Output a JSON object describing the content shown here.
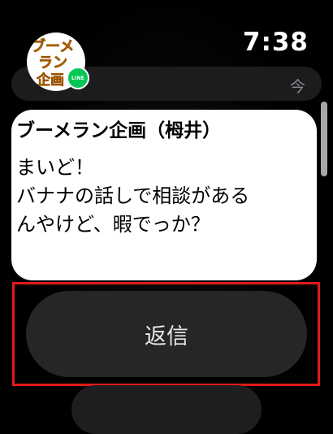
{
  "status": {
    "time": "7:38"
  },
  "notification_stack": {
    "time_label": "今"
  },
  "app_icon": {
    "logo_lines": [
      "ブーメ",
      "ラン",
      "企画"
    ],
    "badge_label": "LINE"
  },
  "notification": {
    "sender": "ブーメラン企画（栂井）",
    "message_lines": [
      "まいど！",
      "バナナの話しで相談がある",
      "んやけど、暇でっか？"
    ]
  },
  "actions": {
    "reply_label": "返信"
  },
  "colors": {
    "background": "#000000",
    "card": "#ffffff",
    "button": "#262628",
    "line_green": "#06c755",
    "logo_orange": "#f29a1a",
    "highlight": "#e11a1a"
  }
}
